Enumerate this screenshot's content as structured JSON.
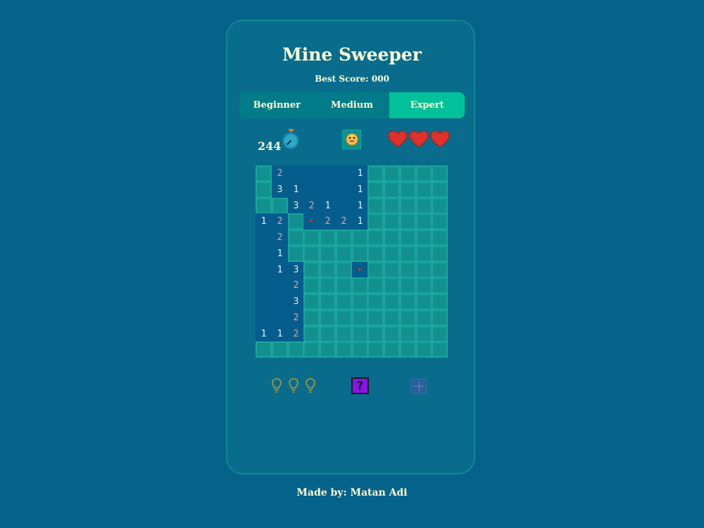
{
  "header": {
    "title": "Mine Sweeper",
    "best_score": "Best Score: 000"
  },
  "levels": [
    {
      "label": "Beginner",
      "active": false
    },
    {
      "label": "Medium",
      "active": false
    },
    {
      "label": "Expert",
      "active": true
    }
  ],
  "status": {
    "timer": "244",
    "lives": 3,
    "face_icon": "smiley-face-icon",
    "timer_icon": "stopwatch-icon"
  },
  "board": {
    "rows": [
      "H2....1HHHHH",
      "H31...1HHHHH",
      "HH321.1HHHHH",
      "12HF221HHHHH",
      ".2HHHHHHHHHH",
      ".1HHHHHHHHHH",
      ".13HHHFHHHHH",
      "..2HHHHHHHHH",
      "..3HHHHHHHHH",
      "..2HHHHHHHHH",
      "112HHHHHHHHH",
      "HHHHHHHHHHHH"
    ],
    "legend": {
      "H": "hidden",
      ".": "open-empty",
      "F": "flag",
      "1-8": "mine-count"
    }
  },
  "tools": {
    "hints": 3,
    "hint_icon": "lightbulb-icon",
    "help_label": "?",
    "add_icon": "plus-icon"
  },
  "colors": {
    "background": "#05628a",
    "card": "#096c8c",
    "accent": "#00c19a",
    "cell_hidden": "#12908f",
    "cell_open": "#045d8c",
    "heart": "#e0302a"
  },
  "footer": {
    "credit": "Made by: Matan Adi"
  }
}
